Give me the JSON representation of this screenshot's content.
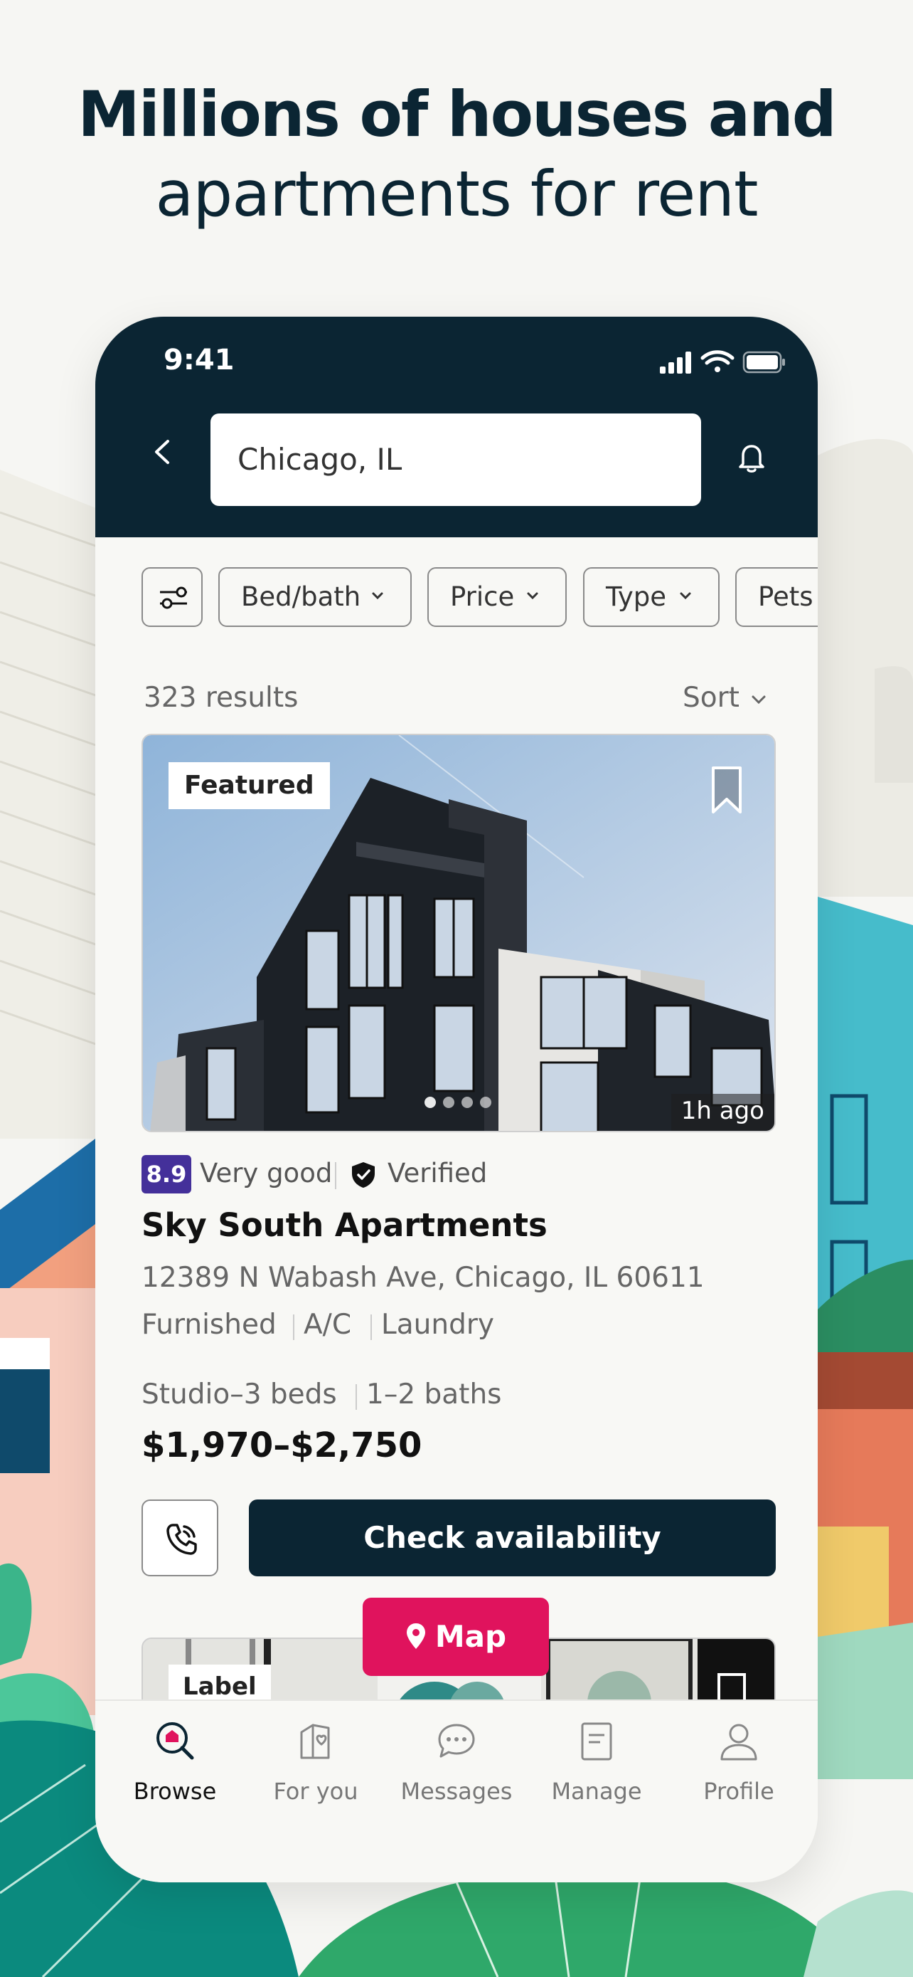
{
  "headline": {
    "line1": "Millions of houses and",
    "line2": "apartments for rent"
  },
  "status_bar": {
    "time": "9:41",
    "icons": [
      "signal-icon",
      "wifi-icon",
      "battery-icon"
    ]
  },
  "search": {
    "value": "Chicago, IL"
  },
  "filters": {
    "settings_icon": "filter-sliders-icon",
    "chips": [
      "Bed/bath",
      "Price",
      "Type",
      "Pets"
    ]
  },
  "results": {
    "count_label": "323 results",
    "sort_label": "Sort"
  },
  "listing": {
    "badge": "Featured",
    "age": "1h ago",
    "photo_count": 4,
    "photo_index": 1,
    "score": "8.9",
    "rating_label": "Very good",
    "verified_label": "Verified",
    "name": "Sky South Apartments",
    "address": "12389 N Wabash Ave, Chicago, IL 60611",
    "amenities": [
      "Furnished",
      "A/C",
      "Laundry"
    ],
    "beds": "Studio–3 beds",
    "baths": "1–2 baths",
    "price": "$1,970–$2,750",
    "cta": "Check availability"
  },
  "next_listing": {
    "badge": "Label"
  },
  "map_button": "Map",
  "tabs": [
    {
      "label": "Browse",
      "icon": "browse-search-icon",
      "active": true
    },
    {
      "label": "For you",
      "icon": "for-you-house-icon",
      "active": false
    },
    {
      "label": "Messages",
      "icon": "messages-bubble-icon",
      "active": false
    },
    {
      "label": "Manage",
      "icon": "manage-document-icon",
      "active": false
    },
    {
      "label": "Profile",
      "icon": "profile-person-icon",
      "active": false
    }
  ],
  "colors": {
    "navy": "#0b2533",
    "accent_pink": "#e0135d",
    "score_purple": "#44309a",
    "background": "#f6f6f3"
  }
}
